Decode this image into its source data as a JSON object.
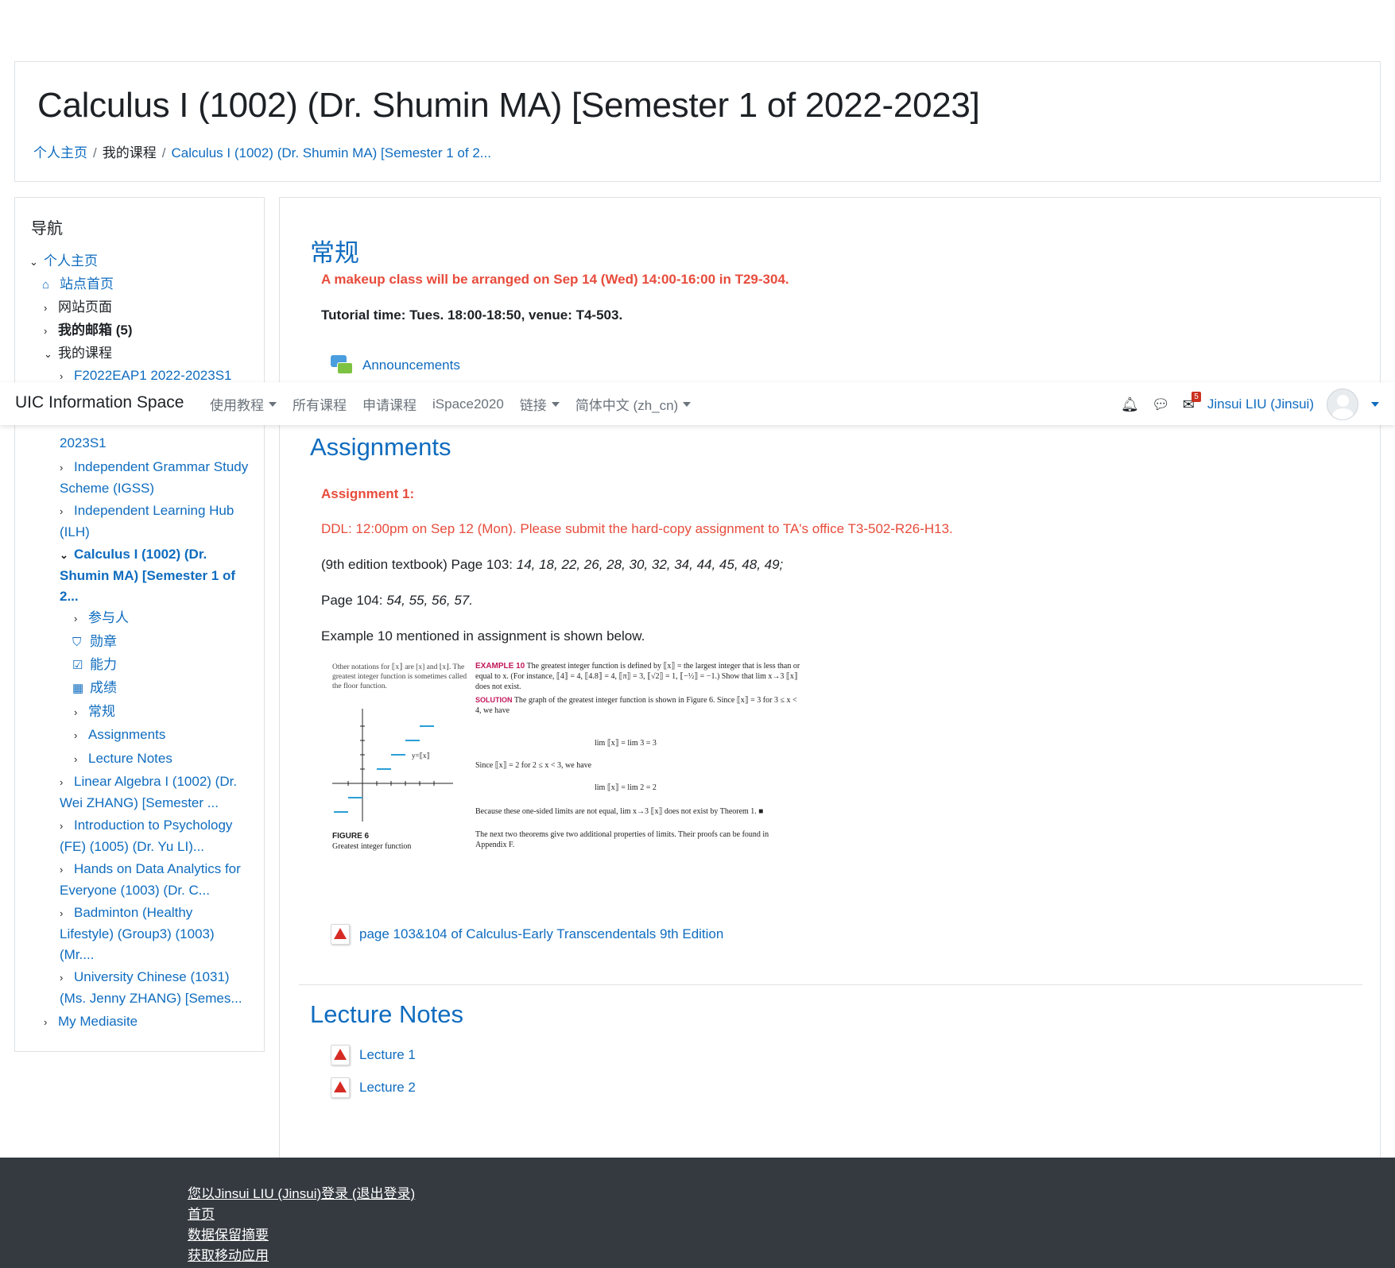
{
  "header": {
    "title": "Calculus I (1002) (Dr. Shumin MA) [Semester 1 of 2022-2023]",
    "breadcrumb": [
      "个人主页",
      "我的课程",
      "Calculus I (1002) (Dr. Shumin MA) [Semester 1 of 2..."
    ]
  },
  "navbar": {
    "brand": "UIC Information Space",
    "menu": [
      "使用教程",
      "所有课程",
      "申请课程",
      "iSpace2020",
      "链接",
      "简体中文 (zh_cn)"
    ],
    "message_badge": "5",
    "user": "Jinsui LIU (Jinsui)"
  },
  "nav": {
    "title": "导航",
    "home": "个人主页",
    "site_home": "站点首页",
    "site_pages": "网站页面",
    "mailbox": "我的邮箱 (5)",
    "my_courses": "我的课程",
    "course_cut_top": "F2022EAP1 2022-2023S1",
    "course_cut_bottom": "2023S1",
    "courses": [
      "Independent Grammar Study Scheme (IGSS)",
      "Independent Learning Hub (ILH)",
      "Calculus I (1002) (Dr. Shumin MA) [Semester 1 of 2...",
      "Linear Algebra I (1002) (Dr. Wei ZHANG) [Semester ...",
      "Introduction to Psychology (FE) (1005) (Dr. Yu LI)...",
      "Hands on Data Analytics for Everyone (1003) (Dr. C...",
      "Badminton (Healthy Lifestyle) (Group3) (1003) (Mr....",
      "University Chinese (1031) (Ms. Jenny ZHANG) [Semes..."
    ],
    "sub": [
      "参与人",
      "勋章",
      "能力",
      "成绩",
      "常规",
      "Assignments",
      "Lecture Notes"
    ],
    "mediasite": "My Mediasite"
  },
  "general": {
    "title": "常规",
    "makeup": "A makeup class will be arranged on Sep 14 (Wed) 14:00-16:00 in T29-304.",
    "tutorial": "Tutorial time: Tues. 18:00-18:50, venue: T4-503.",
    "announcements": "Announcements"
  },
  "assignments": {
    "title": "Assignments",
    "a1": "Assignment 1:",
    "ddl": "DDL: 12:00pm on Sep 12 (Mon). Please submit the hard-copy assignment to TA's office T3-502-R26-H13.",
    "p103_prefix": "(9th edition textbook) Page 103: ",
    "p103_items": "14, 18, 22, 26, 28, 30, 32, 34, 44, 45, 48, 49;",
    "p104_prefix": "Page 104: ",
    "p104_items": "54, 55, 56, 57.",
    "example_note": "Example 10 mentioned in assignment is shown below.",
    "pdf_link": "page 103&104 of Calculus-Early Transcendentals 9th Edition"
  },
  "figure": {
    "side_note": "Other notations for ⟦x⟧ are [x] and ⌊x⌋. The greatest integer function is sometimes called the floor function.",
    "example_head": "EXAMPLE 10",
    "example_text": "The greatest integer function is defined by ⟦x⟧ = the largest integer that is less than or equal to x. (For instance, ⟦4⟧ = 4, ⟦4.8⟧ = 4, ⟦π⟧ = 3, ⟦√2⟧ = 1, ⟦−½⟧ = −1.) Show that lim x→3 ⟦x⟧ does not exist.",
    "solution_head": "SOLUTION",
    "solution_text": "The graph of the greatest integer function is shown in Figure 6. Since ⟦x⟧ = 3 for 3 ≤ x < 4, we have",
    "eq1": "lim ⟦x⟧ = lim 3 = 3",
    "since2": "Since ⟦x⟧ = 2 for 2 ≤ x < 3, we have",
    "eq2": "lim ⟦x⟧ = lim 2 = 2",
    "because": "Because these one-sided limits are not equal, lim x→3 ⟦x⟧ does not exist by Theorem 1. ■",
    "next": "The next two theorems give two additional properties of limits. Their proofs can be found in Appendix F.",
    "fig_label": "FIGURE 6",
    "fig_caption": "Greatest integer function",
    "graph_label": "y=⟦x⟧"
  },
  "lectures": {
    "title": "Lecture Notes",
    "items": [
      "Lecture 1",
      "Lecture 2"
    ]
  },
  "footer": {
    "login": "您以Jinsui LIU (Jinsui)登录 (退出登录)",
    "home": "首页",
    "data": "数据保留摘要",
    "app": "获取移动应用"
  }
}
